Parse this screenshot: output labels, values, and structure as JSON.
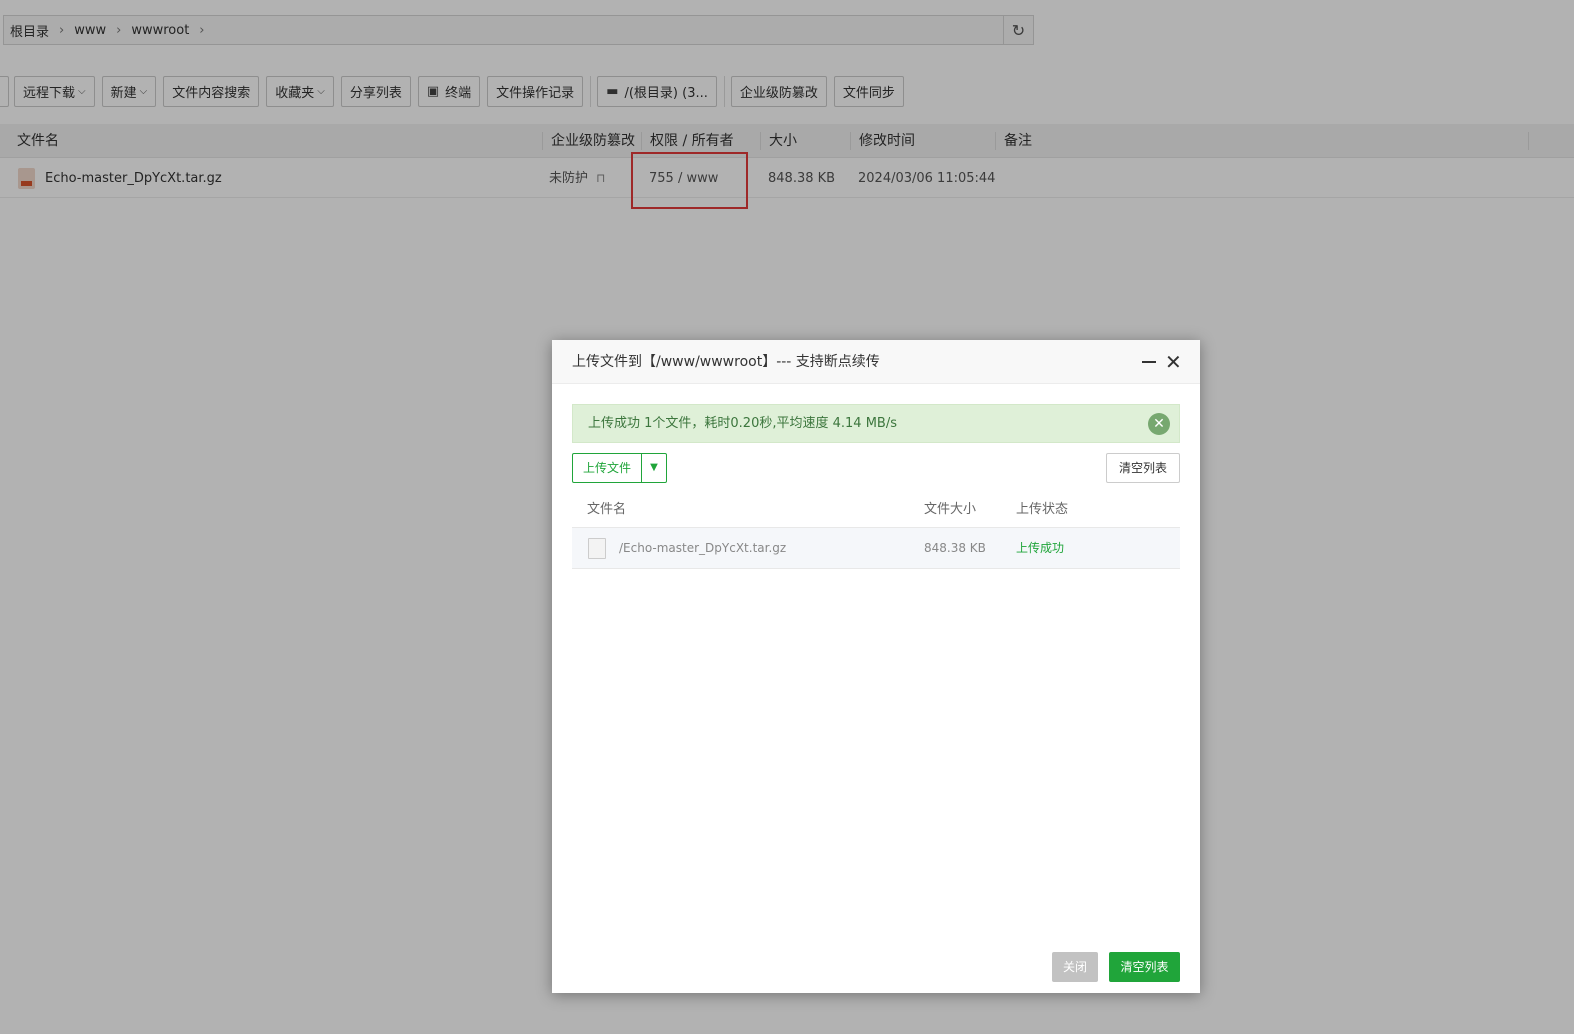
{
  "breadcrumb": {
    "items": [
      "根目录",
      "www",
      "wwwroot"
    ],
    "separator": "›"
  },
  "toolbar": {
    "remote_download": "远程下载",
    "new": "新建",
    "content_search": "文件内容搜索",
    "favorites": "收藏夹",
    "share_list": "分享列表",
    "terminal": "终端",
    "op_log": "文件操作记录",
    "disk": "/(根目录) (3...",
    "tamper_proof": "企业级防篡改",
    "file_sync": "文件同步"
  },
  "file_table": {
    "headers": {
      "name": "文件名",
      "tamper": "企业级防篡改",
      "perm": "权限 / 所有者",
      "size": "大小",
      "mtime": "修改时间",
      "note": "备注"
    },
    "rows": [
      {
        "name": "Echo-master_DpYcXt.tar.gz",
        "tamper": "未防护",
        "perm": "755 / www",
        "size": "848.38 KB",
        "mtime": "2024/03/06 11:05:44",
        "note": ""
      }
    ]
  },
  "upload_dialog": {
    "title": "上传文件到【/www/wwwroot】--- 支持断点续传",
    "alert": "上传成功 1个文件，耗时0.20秒,平均速度 4.14 MB/s",
    "upload_button": "上传文件",
    "clear_list_small": "清空列表",
    "headers": {
      "name": "文件名",
      "size": "文件大小",
      "status": "上传状态"
    },
    "rows": [
      {
        "name": "/Echo-master_DpYcXt.tar.gz",
        "size": "848.38 KB",
        "status": "上传成功"
      }
    ],
    "close_button": "关闭",
    "clear_button": "清空列表"
  },
  "colors": {
    "accent": "#20a53a",
    "highlight_box": "#e23a3a",
    "alert_bg": "#dff0d8",
    "alert_text": "#3c763d"
  },
  "icons": [
    "refresh-icon",
    "chevron-right-icon",
    "chevron-down-icon",
    "terminal-icon",
    "disk-icon",
    "archive-file-icon",
    "unlock-icon",
    "minimize-icon",
    "close-icon",
    "dismiss-alert-icon",
    "caret-down-icon",
    "document-icon"
  ]
}
